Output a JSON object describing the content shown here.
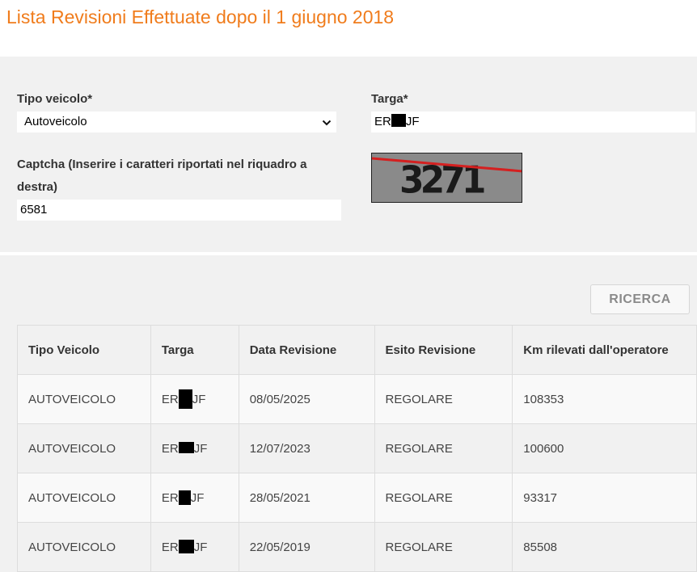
{
  "page": {
    "title": "Lista Revisioni Effettuate dopo il 1 giugno 2018"
  },
  "form": {
    "vehicle_type_label": "Tipo veicolo*",
    "vehicle_type_value": "Autoveicolo",
    "plate_label": "Targa*",
    "plate_prefix": "ER",
    "plate_suffix": "JF",
    "captcha_label": "Captcha (Inserire i caratteri riportati nel riquadro a destra)",
    "captcha_value": "6581",
    "captcha_image_text": "3271"
  },
  "search_button": {
    "label": "RICERCA"
  },
  "table": {
    "headers": [
      "Tipo Veicolo",
      "Targa",
      "Data Revisione",
      "Esito Revisione",
      "Km rilevati dall'operatore"
    ],
    "rows": [
      {
        "tipo": "AUTOVEICOLO",
        "targa_prefix": "ER",
        "targa_suffix": "JF",
        "data": "08/05/2025",
        "esito": "REGOLARE",
        "km": "108353"
      },
      {
        "tipo": "AUTOVEICOLO",
        "targa_prefix": "ER",
        "targa_suffix": "JF",
        "data": "12/07/2023",
        "esito": "REGOLARE",
        "km": "100600"
      },
      {
        "tipo": "AUTOVEICOLO",
        "targa_prefix": "ER",
        "targa_suffix": "JF",
        "data": "28/05/2021",
        "esito": "REGOLARE",
        "km": "93317"
      },
      {
        "tipo": "AUTOVEICOLO",
        "targa_prefix": "ER",
        "targa_suffix": "JF",
        "data": "22/05/2019",
        "esito": "REGOLARE",
        "km": "85508"
      }
    ]
  },
  "colors": {
    "title": "#f07c1c",
    "panel_background": "#f1f1f1",
    "captcha_background": "#8a8a8a",
    "captcha_line": "#d42020",
    "redaction": "#000000"
  },
  "icons": {
    "select": "chevron-down-icon",
    "redaction": "redaction-block"
  }
}
